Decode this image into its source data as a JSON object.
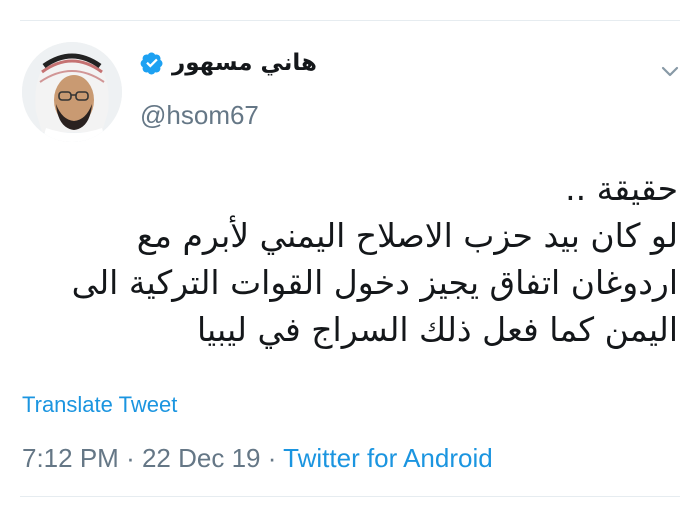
{
  "tweet": {
    "display_name": "هاني مسهور",
    "handle": "@hsom67",
    "verified_icon": "verified-badge-icon",
    "menu_icon": "chevron-down-icon",
    "text_lines": [
      "حقيقة ..",
      "لو كان بيد حزب الاصلاح اليمني لأبرم مع",
      "اردوغان اتفاق يجيز دخول القوات التركية الى",
      "اليمن كما فعل ذلك السراج في ليبيا"
    ],
    "translate_label": "Translate Tweet",
    "time": "7:12 PM",
    "separator": "·",
    "date": "22 Dec 19",
    "source": "Twitter for Android"
  },
  "colors": {
    "accent": "#1b95e0",
    "text": "#14171a",
    "secondary": "#657786",
    "divider": "#e6ecf0"
  }
}
